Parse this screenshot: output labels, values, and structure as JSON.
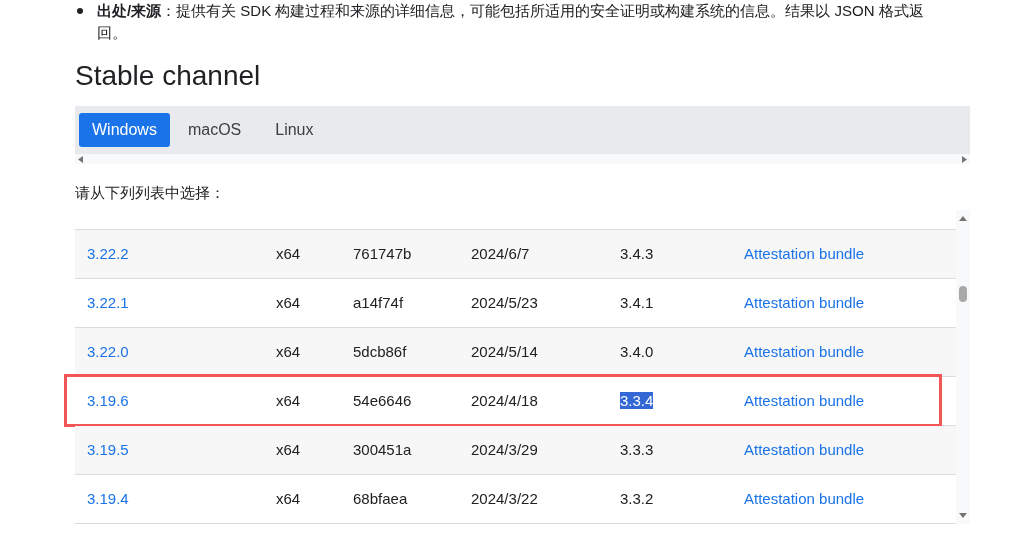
{
  "intro": {
    "label": "出处/来源",
    "text": "：提供有关 SDK 构建过程和来源的详细信息，可能包括所适用的安全证明或构建系统的信息。结果以 JSON 格式返回。"
  },
  "heading": "Stable channel",
  "tabs": [
    {
      "label": "Windows",
      "selected": true
    },
    {
      "label": "macOS",
      "selected": false
    },
    {
      "label": "Linux",
      "selected": false
    }
  ],
  "prompt": "请从下列列表中选择：",
  "rows": [
    {
      "version": "3.22.2",
      "arch": "x64",
      "hash": "761747b",
      "date": "2024/6/7",
      "dart": "3.4.3",
      "link": "Attestation bundle",
      "highlighted": false
    },
    {
      "version": "3.22.1",
      "arch": "x64",
      "hash": "a14f74f",
      "date": "2024/5/23",
      "dart": "3.4.1",
      "link": "Attestation bundle",
      "highlighted": false
    },
    {
      "version": "3.22.0",
      "arch": "x64",
      "hash": "5dcb86f",
      "date": "2024/5/14",
      "dart": "3.4.0",
      "link": "Attestation bundle",
      "highlighted": false
    },
    {
      "version": "3.19.6",
      "arch": "x64",
      "hash": "54e6646",
      "date": "2024/4/18",
      "dart": "3.3.4",
      "link": "Attestation bundle",
      "highlighted": true
    },
    {
      "version": "3.19.5",
      "arch": "x64",
      "hash": "300451a",
      "date": "2024/3/29",
      "dart": "3.3.3",
      "link": "Attestation bundle",
      "highlighted": false
    },
    {
      "version": "3.19.4",
      "arch": "x64",
      "hash": "68bfaea",
      "date": "2024/3/22",
      "dart": "3.3.2",
      "link": "Attestation bundle",
      "highlighted": false
    }
  ]
}
